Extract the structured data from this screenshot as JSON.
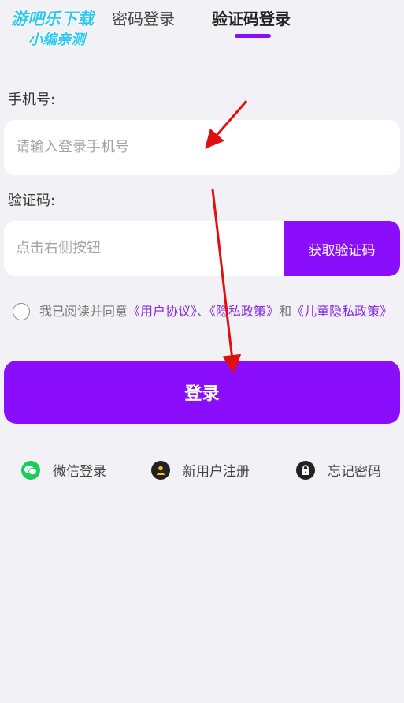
{
  "watermark": {
    "line1": "游吧乐下载",
    "line2": "小编亲测"
  },
  "tabs": [
    {
      "label": "密码登录",
      "active": false
    },
    {
      "label": "验证码登录",
      "active": true
    }
  ],
  "phone": {
    "label": "手机号:",
    "placeholder": "请输入登录手机号",
    "value": ""
  },
  "code": {
    "label": "验证码:",
    "placeholder": "点击右侧按钮",
    "value": "",
    "button_label": "获取验证码"
  },
  "agreement": {
    "prefix": "我已阅读并同意",
    "user_agreement": "《用户协议》",
    "sep1": "、",
    "privacy_policy": "《隐私政策》",
    "and": "和",
    "child_privacy": "《儿童隐私政策》",
    "checked": false
  },
  "login_button": "登录",
  "bottom_links": {
    "wechat": {
      "label": "微信登录",
      "icon": "wechat-icon"
    },
    "register": {
      "label": "新用户注册",
      "icon": "user-icon"
    },
    "forgot": {
      "label": "忘记密码",
      "icon": "lock-icon"
    }
  },
  "colors": {
    "accent": "#8a0dfc",
    "background": "#f2f1f6",
    "wechat": "#1ccc5a",
    "annotation_arrow": "#e01010"
  }
}
